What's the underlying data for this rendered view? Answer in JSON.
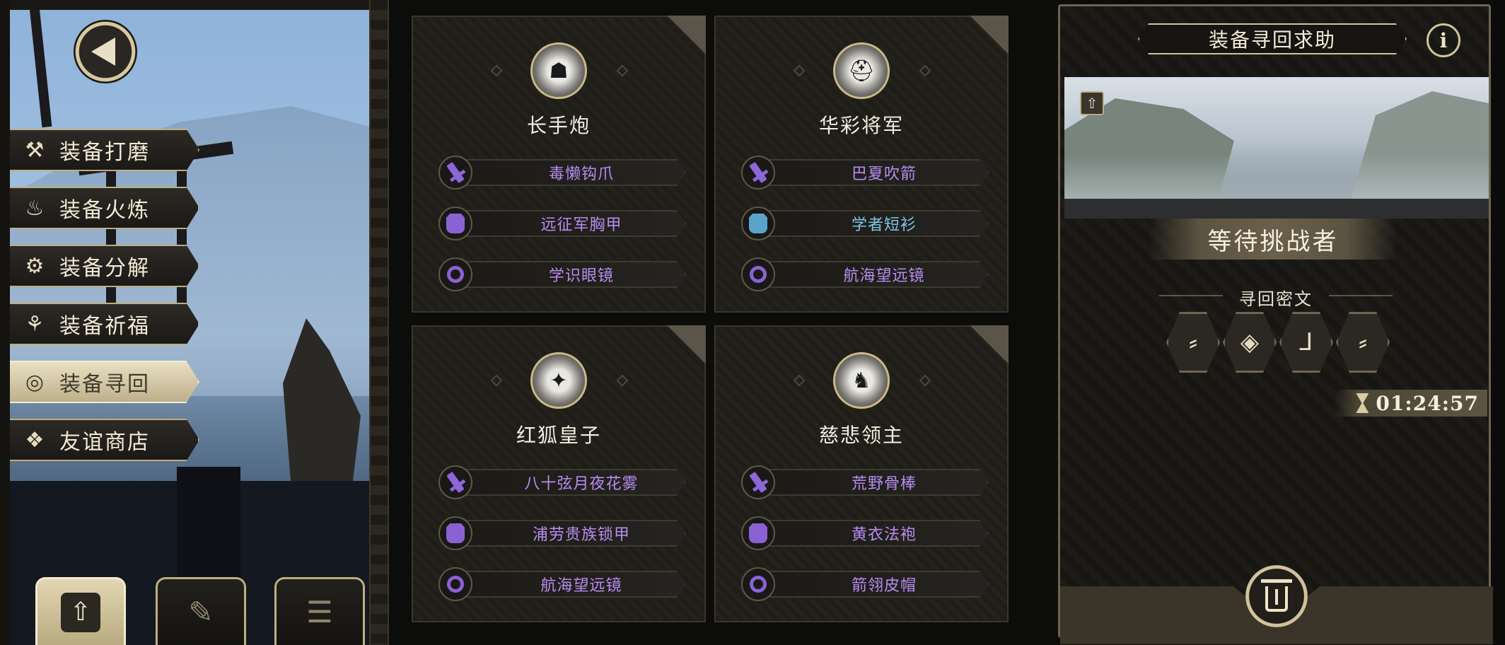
{
  "side_menu": {
    "items": [
      {
        "label": "装备打磨",
        "icon": "hammer-icon",
        "glyph": "⚒",
        "active": false
      },
      {
        "label": "装备火炼",
        "icon": "flame-icon",
        "glyph": "♨",
        "active": false
      },
      {
        "label": "装备分解",
        "icon": "gear-break-icon",
        "glyph": "⚙",
        "active": false
      },
      {
        "label": "装备祈福",
        "icon": "lotus-icon",
        "glyph": "⚘",
        "active": false
      },
      {
        "label": "装备寻回",
        "icon": "target-icon",
        "glyph": "◎",
        "active": true
      },
      {
        "label": "友谊商店",
        "icon": "fox-icon",
        "glyph": "❖",
        "active": false
      }
    ]
  },
  "bottom_tabs": [
    {
      "icon": "upload-icon",
      "glyph": "⇧",
      "active": true
    },
    {
      "icon": "feather-icon",
      "glyph": "✎",
      "active": false
    },
    {
      "icon": "list-icon",
      "glyph": "☰",
      "active": false
    }
  ],
  "cards": [
    {
      "name": "长手炮",
      "portrait": "boar-portrait-icon",
      "slots": [
        {
          "label": "毒懒钩爪",
          "type": "weapon",
          "color": "#b88cf0"
        },
        {
          "label": "远征军胸甲",
          "type": "armor",
          "color": "#b88cf0"
        },
        {
          "label": "学识眼镜",
          "type": "ring",
          "color": "#b88cf0"
        }
      ]
    },
    {
      "name": "华彩将军",
      "portrait": "helmet-portrait-icon",
      "slots": [
        {
          "label": "巴夏吹箭",
          "type": "weapon",
          "color": "#b88cf0"
        },
        {
          "label": "学者短衫",
          "type": "armor-blue",
          "color": "#7cc6ec"
        },
        {
          "label": "航海望远镜",
          "type": "ring",
          "color": "#b88cf0"
        }
      ]
    },
    {
      "name": "红狐皇子",
      "portrait": "fox-portrait-icon",
      "slots": [
        {
          "label": "八十弦月夜花雾",
          "type": "weapon",
          "color": "#b88cf0"
        },
        {
          "label": "浦劳贵族锁甲",
          "type": "armor",
          "color": "#b88cf0"
        },
        {
          "label": "航海望远镜",
          "type": "ring",
          "color": "#b88cf0"
        }
      ]
    },
    {
      "name": "慈悲领主",
      "portrait": "knight-portrait-icon",
      "slots": [
        {
          "label": "荒野骨棒",
          "type": "weapon",
          "color": "#b88cf0"
        },
        {
          "label": "黄衣法袍",
          "type": "armor",
          "color": "#b88cf0"
        },
        {
          "label": "箭翎皮帽",
          "type": "ring",
          "color": "#b88cf0"
        }
      ]
    }
  ],
  "panel": {
    "title": "装备寻回求助",
    "info_label": "i",
    "status": "等待挑战者",
    "cipher_label": "寻回密文",
    "runes": [
      "⸗",
      "◈",
      "⅃",
      "⸗"
    ],
    "timer": "01:24:57"
  }
}
